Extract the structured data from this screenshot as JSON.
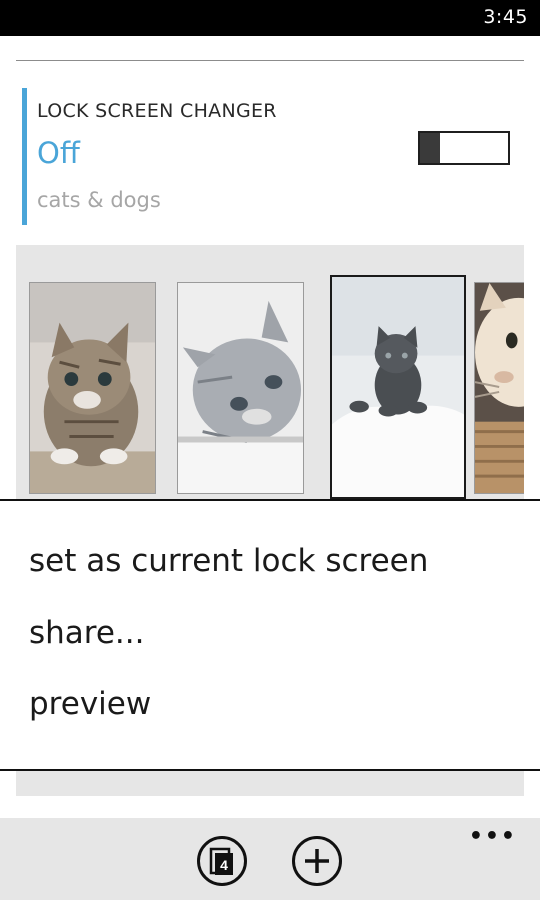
{
  "status_bar": {
    "time": "3:45"
  },
  "setting": {
    "title": "LOCK SCREEN CHANGER",
    "state": "Off",
    "subtitle": "cats & dogs",
    "toggle_on": false,
    "accent_color": "#4aa5d8"
  },
  "gallery": {
    "images": [
      {
        "name": "tabby-kitten-photo",
        "selected": false
      },
      {
        "name": "gray-kitten-photo",
        "selected": false
      },
      {
        "name": "black-kitten-photo",
        "selected": true
      },
      {
        "name": "cream-cat-photo",
        "selected": false
      }
    ]
  },
  "context_menu": {
    "items": [
      {
        "label": "set as current lock screen"
      },
      {
        "label": "share..."
      },
      {
        "label": "preview"
      }
    ]
  },
  "app_bar": {
    "icons": [
      "lock-screen-count-icon",
      "add-icon",
      "more-icon"
    ],
    "badge": "4",
    "more": "•••"
  }
}
